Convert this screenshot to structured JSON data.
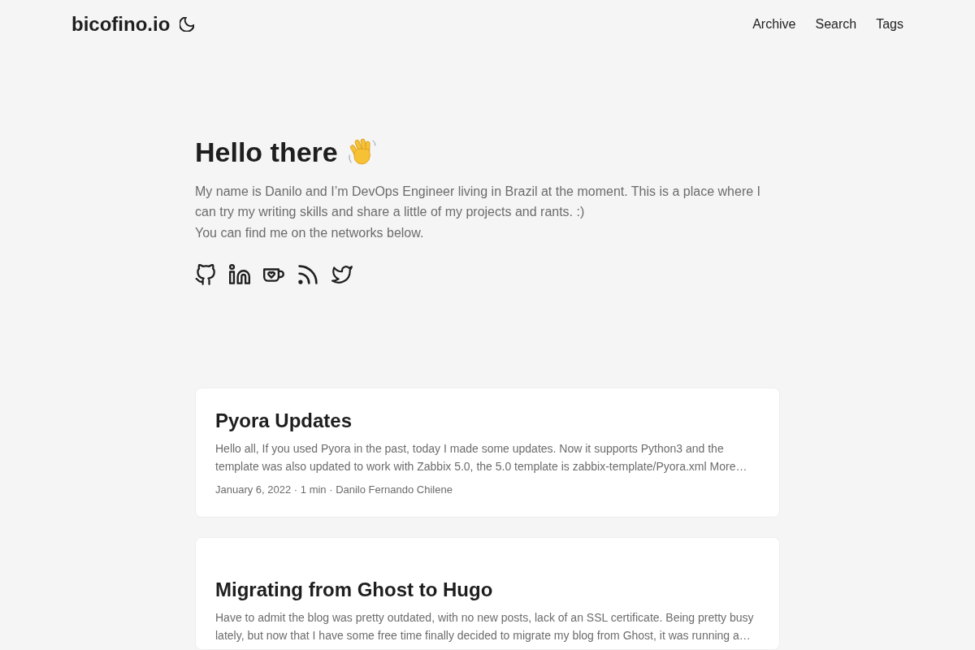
{
  "header": {
    "logo": "bicofino.io",
    "nav": [
      {
        "label": "Archive"
      },
      {
        "label": "Search"
      },
      {
        "label": "Tags"
      }
    ]
  },
  "intro": {
    "title": "Hello there",
    "paragraphs": [
      "My name is Danilo and I’m DevOps Engineer living in Brazil at the moment. This is a place where I can try my writing skills and share a little of my projects and rants. :)",
      "You can find me on the networks below."
    ],
    "social": [
      {
        "kind": "github"
      },
      {
        "kind": "linkedin"
      },
      {
        "kind": "kofi"
      },
      {
        "kind": "rss"
      },
      {
        "kind": "twitter"
      }
    ]
  },
  "posts": [
    {
      "title": "Pyora Updates",
      "summary": "Hello all, If you used Pyora in the past, today I made some updates. Now it supports Python3 and the template was also updated to work with Zabbix 5.0, the 5.0 template is zabbix-template/Pyora.xml More…",
      "meta": "January 6, 2022 · 1 min · Danilo Fernando Chilene"
    },
    {
      "title": "Migrating from Ghost to Hugo",
      "summary": "Have to admit the blog was pretty outdated, with no new posts, lack of an SSL certificate. Being pretty busy lately, but now that I have some free time finally decided to migrate my blog from Ghost, it was running a…"
    }
  ]
}
